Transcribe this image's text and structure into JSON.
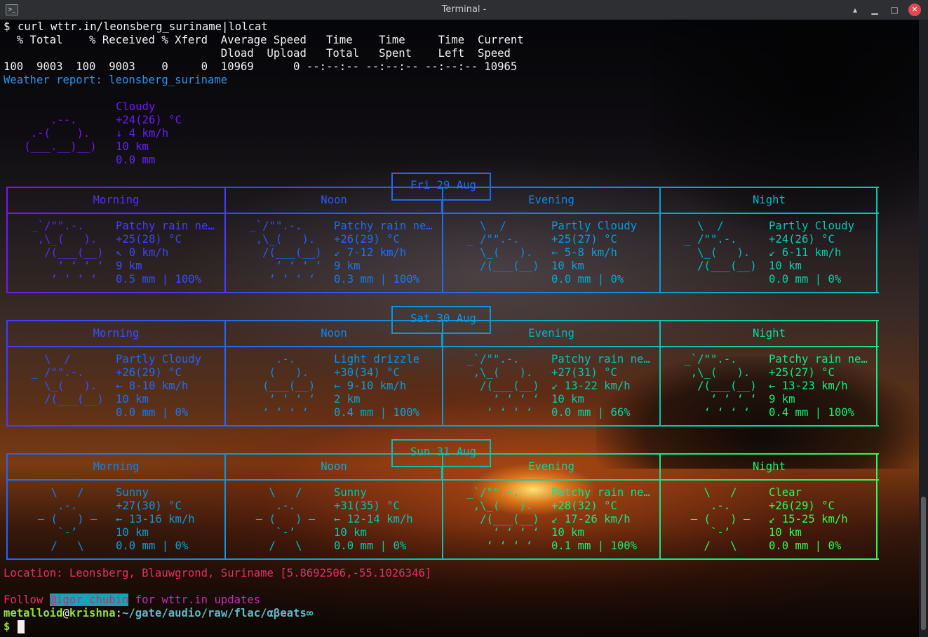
{
  "window": {
    "title": "Terminal -",
    "app_icon": "terminal-icon",
    "controls": [
      "minimize-icon",
      "minimize-icon",
      "maximize-icon",
      "close-icon"
    ]
  },
  "terminal": {
    "command_prompt": "$",
    "command": "curl wttr.in/leonsberg_suriname|lolcat",
    "curl_header1": "  % Total    % Received % Xferd  Average Speed   Time    Time     Time  Current",
    "curl_header2": "                                 Dload  Upload   Total   Spent    Left  Speed",
    "curl_progress": "100  9003  100  9003    0     0  10969      0 --:--:-- --:--:-- --:--:-- 10965",
    "report_title": "Weather report: leonsberg_suriname",
    "current": {
      "art": [
        "",
        "     .--.    ",
        "  .-(    ).  ",
        " (___.__)__) ",
        "             "
      ],
      "lines": [
        "Cloudy",
        "+24(26) °C",
        "↓ 4 km/h",
        "10 km",
        "0.0 mm"
      ]
    },
    "days": [
      {
        "date": "Fri 29 Aug",
        "periods": [
          {
            "name": "Morning",
            "art": [
              " _`/\"\".-.    ",
              "  ,\\_(   ).  ",
              "   /(___(__) ",
              "     ‘ ‘ ‘ ‘ ",
              "    ‘ ‘ ‘ ‘  "
            ],
            "lines": [
              "Patchy rain ne…",
              "+25(28) °C",
              "↖ 0 km/h",
              "9 km",
              "0.5 mm | 100%"
            ]
          },
          {
            "name": "Noon",
            "art": [
              " _`/\"\".-.    ",
              "  ,\\_(   ).  ",
              "   /(___(__) ",
              "     ‘ ‘ ‘ ‘ ",
              "    ‘ ‘ ‘ ‘  "
            ],
            "lines": [
              "Patchy rain ne…",
              "+26(29) °C",
              "↙ 7-12 km/h",
              "9 km",
              "0.3 mm | 100%"
            ]
          },
          {
            "name": "Evening",
            "art": [
              "   \\  /      ",
              " _ /\"\".-.    ",
              "   \\_(   ).  ",
              "   /(___(__) ",
              "             "
            ],
            "lines": [
              "Partly Cloudy",
              "+25(27) °C",
              "← 5-8 km/h",
              "10 km",
              "0.0 mm | 0%"
            ]
          },
          {
            "name": "Night",
            "art": [
              "   \\  /      ",
              " _ /\"\".-.    ",
              "   \\_(   ).  ",
              "   /(___(__) ",
              "             "
            ],
            "lines": [
              "Partly Cloudy",
              "+24(26) °C",
              "↙ 6-11 km/h",
              "10 km",
              "0.0 mm | 0%"
            ]
          }
        ]
      },
      {
        "date": "Sat 30 Aug",
        "periods": [
          {
            "name": "Morning",
            "art": [
              "   \\  /      ",
              " _ /\"\".-.    ",
              "   \\_(   ).  ",
              "   /(___(__) ",
              "             "
            ],
            "lines": [
              "Partly Cloudy",
              "+26(29) °C",
              "← 8-10 km/h",
              "10 km",
              "0.0 mm | 0%"
            ]
          },
          {
            "name": "Noon",
            "art": [
              "     .-.     ",
              "    (   ).   ",
              "   (___(__)  ",
              "    ‘ ‘ ‘ ‘  ",
              "   ‘ ‘ ‘ ‘   "
            ],
            "lines": [
              "Light drizzle",
              "+30(34) °C",
              "← 9-10 km/h",
              "2 km",
              "0.4 mm | 100%"
            ]
          },
          {
            "name": "Evening",
            "art": [
              " _`/\"\".-.    ",
              "  ,\\_(   ).  ",
              "   /(___(__) ",
              "     ‘ ‘ ‘ ‘ ",
              "    ‘ ‘ ‘ ‘  "
            ],
            "lines": [
              "Patchy rain ne…",
              "+27(31) °C",
              "↙ 13-22 km/h",
              "10 km",
              "0.0 mm | 66%"
            ]
          },
          {
            "name": "Night",
            "art": [
              " _`/\"\".-.    ",
              "  ,\\_(   ).  ",
              "   /(___(__) ",
              "     ‘ ‘ ‘ ‘ ",
              "    ‘ ‘ ‘ ‘  "
            ],
            "lines": [
              "Patchy rain ne…",
              "+25(27) °C",
              "← 13-23 km/h",
              "9 km",
              "0.4 mm | 100%"
            ]
          }
        ]
      },
      {
        "date": "Sun 31 Aug",
        "periods": [
          {
            "name": "Morning",
            "art": [
              "    \\   /    ",
              "     .-.     ",
              "  ― (   ) ―  ",
              "     `-’     ",
              "    /   \\    "
            ],
            "lines": [
              "Sunny",
              "+27(30) °C",
              "← 13-16 km/h",
              "10 km",
              "0.0 mm | 0%"
            ]
          },
          {
            "name": "Noon",
            "art": [
              "    \\   /    ",
              "     .-.     ",
              "  ― (   ) ―  ",
              "     `-’     ",
              "    /   \\    "
            ],
            "lines": [
              "Sunny",
              "+31(35) °C",
              "← 12-14 km/h",
              "10 km",
              "0.0 mm | 0%"
            ]
          },
          {
            "name": "Evening",
            "art": [
              " _`/\"\".-.    ",
              "  ,\\_(   ).  ",
              "   /(___(__) ",
              "     ‘ ‘ ‘ ‘ ",
              "    ‘ ‘ ‘ ‘  "
            ],
            "lines": [
              "Patchy rain ne…",
              "+28(32) °C",
              "↙ 17-26 km/h",
              "10 km",
              "0.1 mm | 100%"
            ]
          },
          {
            "name": "Night",
            "art": [
              "    \\   /    ",
              "     .-.     ",
              "  ― (   ) ―  ",
              "     `-’     ",
              "    /   \\    "
            ],
            "lines": [
              "Clear",
              "+26(29) °C",
              "↙ 15-25 km/h",
              "10 km",
              "0.0 mm | 0%"
            ]
          }
        ]
      }
    ],
    "location": "Location: Leonsberg, Blauwgrond, Suriname [5.8692506,-55.1026346]",
    "follow": {
      "prefix": "Follow ",
      "handle": "@igor_chubin",
      "suffix": " for wttr.in updates"
    },
    "prompt": {
      "user": "metalloid",
      "at": "@",
      "host": "krishna",
      "sep": ":",
      "path": "~/gate/audio/raw/flac/αβeats∞",
      "symbol": "$ "
    }
  },
  "colors": {
    "text_white": "#f2f2f2",
    "prompt_green": "#8ee03a",
    "prompt_path": "#5fb8c8",
    "follow_highlight": "#17a2b8"
  }
}
